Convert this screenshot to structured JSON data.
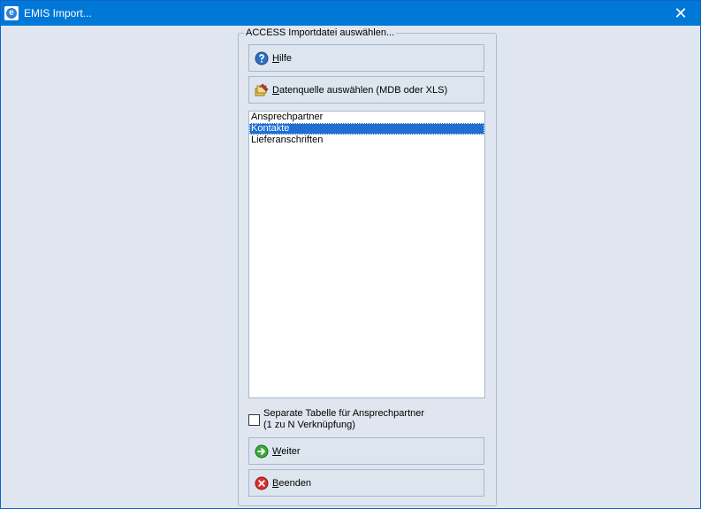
{
  "window": {
    "title": "EMIS Import...",
    "close_glyph": "✕"
  },
  "group": {
    "legend": "ACCESS Importdatei auswählen..."
  },
  "buttons": {
    "help": {
      "mnemonic": "H",
      "rest": "ilfe",
      "icon": "help-icon"
    },
    "datasource": {
      "mnemonic": "D",
      "rest": "atenquelle auswählen (MDB oder XLS)",
      "icon": "datasource-icon"
    },
    "next": {
      "mnemonic": "W",
      "rest": "eiter",
      "icon": "arrow-right-icon"
    },
    "quit": {
      "mnemonic": "B",
      "rest": "eenden",
      "icon": "close-icon"
    }
  },
  "list": {
    "items": [
      "Ansprechpartner",
      "Kontakte",
      "Lieferanschriften"
    ],
    "selected_index": 1
  },
  "checkbox": {
    "line1": "Separate Tabelle für Ansprechpartner",
    "line2": "(1 zu N Verknüpfung)",
    "checked": false
  },
  "colors": {
    "titlebar": "#0078d7",
    "selection": "#1f6fd1",
    "background": "#dfe6ef"
  }
}
